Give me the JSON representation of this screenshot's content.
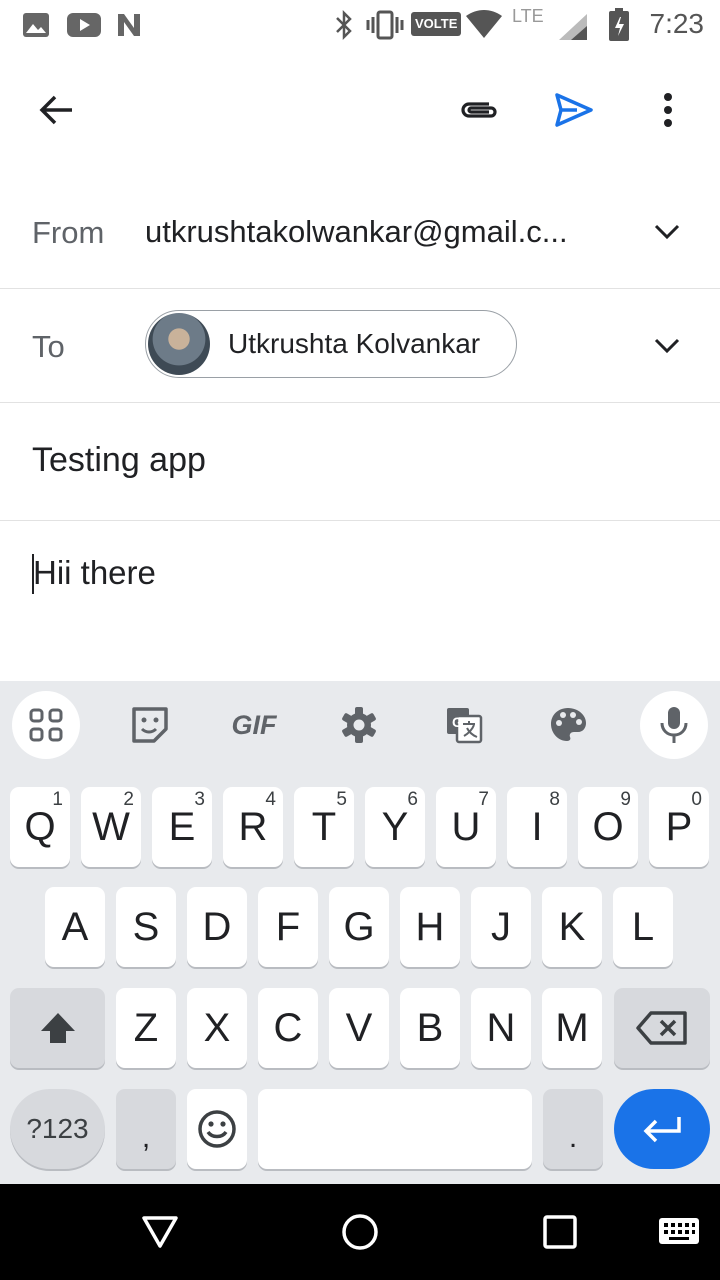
{
  "status_bar": {
    "time": "7:23",
    "volte_label": "VOLTE",
    "network_label": "LTE",
    "left_icons": [
      "image-icon",
      "youtube-icon",
      "n-app-icon"
    ],
    "right_icons": [
      "bluetooth-icon",
      "vibrate-icon",
      "volte-icon",
      "wifi-icon",
      "lte-signal-icon",
      "battery-icon"
    ]
  },
  "app_bar": {
    "back_icon": "arrow-back-icon",
    "attach_icon": "attachment-icon",
    "send_icon": "send-icon",
    "more_icon": "more-vert-icon",
    "accent_color": "#1a73e8"
  },
  "compose": {
    "from_label": "From",
    "from_value": "utkrushtakolwankar@gmail.c...",
    "to_label": "To",
    "to_chip_name": "Utkrushta Kolvankar",
    "subject": "Testing app",
    "body": "Hii there"
  },
  "keyboard": {
    "toolbar": [
      "apps-grid-icon",
      "sticker-icon",
      "gif-icon",
      "settings-gear-icon",
      "translate-icon",
      "palette-icon",
      "mic-icon"
    ],
    "gif_label": "GIF",
    "row1": [
      {
        "k": "Q",
        "n": "1"
      },
      {
        "k": "W",
        "n": "2"
      },
      {
        "k": "E",
        "n": "3"
      },
      {
        "k": "R",
        "n": "4"
      },
      {
        "k": "T",
        "n": "5"
      },
      {
        "k": "Y",
        "n": "6"
      },
      {
        "k": "U",
        "n": "7"
      },
      {
        "k": "I",
        "n": "8"
      },
      {
        "k": "O",
        "n": "9"
      },
      {
        "k": "P",
        "n": "0"
      }
    ],
    "row2": [
      "A",
      "S",
      "D",
      "F",
      "G",
      "H",
      "J",
      "K",
      "L"
    ],
    "row3": [
      "Z",
      "X",
      "C",
      "V",
      "B",
      "N",
      "M"
    ],
    "symbols_label": "?123",
    "comma_label": ",",
    "period_label": ".",
    "enter_color": "#1a73e8"
  },
  "nav_bar": {
    "icons": [
      "back-triangle-icon",
      "home-circle-icon",
      "recents-square-icon",
      "keyboard-switch-icon"
    ]
  }
}
